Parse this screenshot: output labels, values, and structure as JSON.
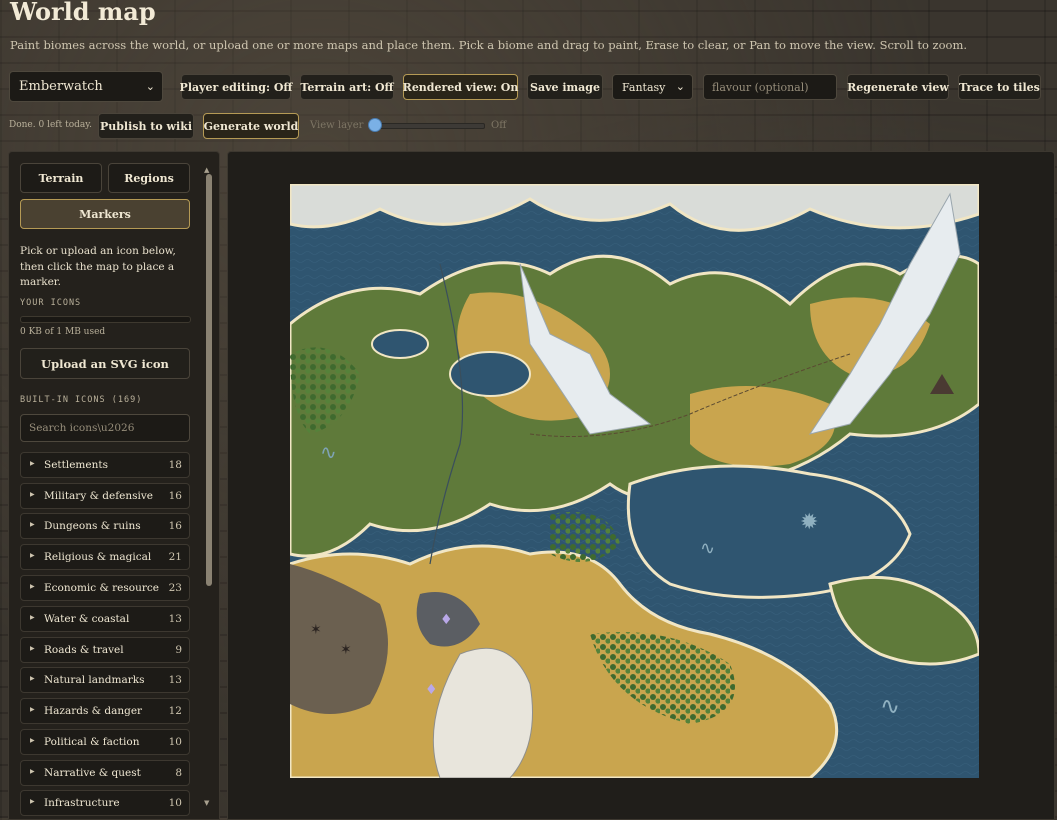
{
  "header": {
    "title": "World map",
    "subtitle": "Paint biomes across the world, or upload one or more maps and place them. Pick a biome and drag to paint, Erase to clear, or Pan to move the view. Scroll to zoom."
  },
  "toolbar": {
    "world_select": "Emberwatch",
    "player_editing": "Player editing: Off",
    "terrain_art": "Terrain art: Off",
    "rendered_view": "Rendered view: On",
    "save_image": "Save image",
    "style_select": "Fantasy",
    "flavour_placeholder": "flavour (optional)",
    "regenerate_view": "Regenerate view",
    "trace_to_tiles": "Trace to tiles",
    "status": "Done. 0 left today.",
    "publish_to_wiki": "Publish to wiki",
    "generate_world": "Generate world",
    "view_layer_label": "View layer",
    "view_layer_state": "Off"
  },
  "sidebar": {
    "tabs": [
      "Terrain",
      "Regions",
      "Markers"
    ],
    "active_tab": "Markers",
    "help": "Pick or upload an icon below, then click the map to place a marker.",
    "your_icons_label": "YOUR ICONS",
    "quota_text": "0 KB of 1 MB used",
    "upload_button": "Upload an SVG icon",
    "builtin_label": "BUILT-IN ICONS (169)",
    "search_placeholder": "Search icons\\u2026",
    "categories": [
      {
        "name": "Settlements",
        "count": "18"
      },
      {
        "name": "Military & defensive",
        "count": "16"
      },
      {
        "name": "Dungeons & ruins",
        "count": "16"
      },
      {
        "name": "Religious & magical",
        "count": "21"
      },
      {
        "name": "Economic & resource",
        "count": "23"
      },
      {
        "name": "Water & coastal",
        "count": "13"
      },
      {
        "name": "Roads & travel",
        "count": "9"
      },
      {
        "name": "Natural landmarks",
        "count": "13"
      },
      {
        "name": "Hazards & danger",
        "count": "12"
      },
      {
        "name": "Political & faction",
        "count": "10"
      },
      {
        "name": "Narrative & quest",
        "count": "8"
      },
      {
        "name": "Infrastructure",
        "count": "10"
      }
    ]
  },
  "colors": {
    "accent_gold": "#b59a55",
    "sea": "#2f5570",
    "land_green": "#5f7a3a",
    "land_yellow": "#c9a54e",
    "snow": "#e7ecef"
  },
  "icons": [
    "chevron-down-icon",
    "caret-right-icon",
    "sea-serpent-icon",
    "kraken-icon",
    "volcano-icon",
    "dead-tree-icon",
    "crystal-icon"
  ]
}
